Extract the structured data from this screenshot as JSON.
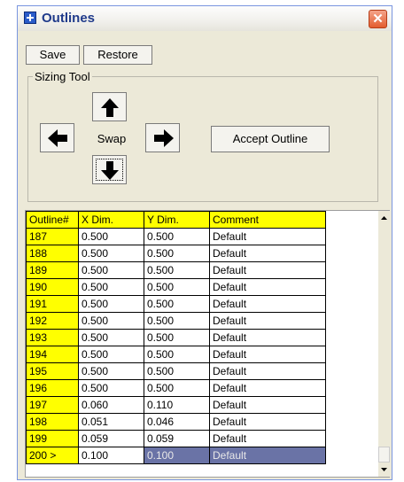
{
  "window": {
    "title": "Outlines",
    "close_label": "✕"
  },
  "toolbar": {
    "save_label": "Save",
    "restore_label": "Restore"
  },
  "sizing_tool": {
    "label": "Sizing Tool",
    "swap_label": "Swap",
    "accept_label": "Accept Outline"
  },
  "table": {
    "headers": [
      "Outline#",
      "X Dim.",
      "Y Dim.",
      "Comment"
    ],
    "rows": [
      [
        "187",
        "0.500",
        "0.500",
        "Default"
      ],
      [
        "188",
        "0.500",
        "0.500",
        "Default"
      ],
      [
        "189",
        "0.500",
        "0.500",
        "Default"
      ],
      [
        "190",
        "0.500",
        "0.500",
        "Default"
      ],
      [
        "191",
        "0.500",
        "0.500",
        "Default"
      ],
      [
        "192",
        "0.500",
        "0.500",
        "Default"
      ],
      [
        "193",
        "0.500",
        "0.500",
        "Default"
      ],
      [
        "194",
        "0.500",
        "0.500",
        "Default"
      ],
      [
        "195",
        "0.500",
        "0.500",
        "Default"
      ],
      [
        "196",
        "0.500",
        "0.500",
        "Default"
      ],
      [
        "197",
        "0.060",
        "0.110",
        "Default"
      ],
      [
        "198",
        "0.051",
        "0.046",
        "Default"
      ],
      [
        "199",
        "0.059",
        "0.059",
        "Default"
      ],
      [
        "200 >",
        "0.100",
        "0.100",
        "Default"
      ]
    ]
  },
  "colors": {
    "header_bg": "#ffff00",
    "selection_bg": "#6a73a6",
    "title_text": "#1f3a8a"
  },
  "icons": {
    "app": "grid-icon",
    "up": "arrow-up-icon",
    "down": "arrow-down-icon",
    "left": "arrow-left-icon",
    "right": "arrow-right-icon"
  }
}
